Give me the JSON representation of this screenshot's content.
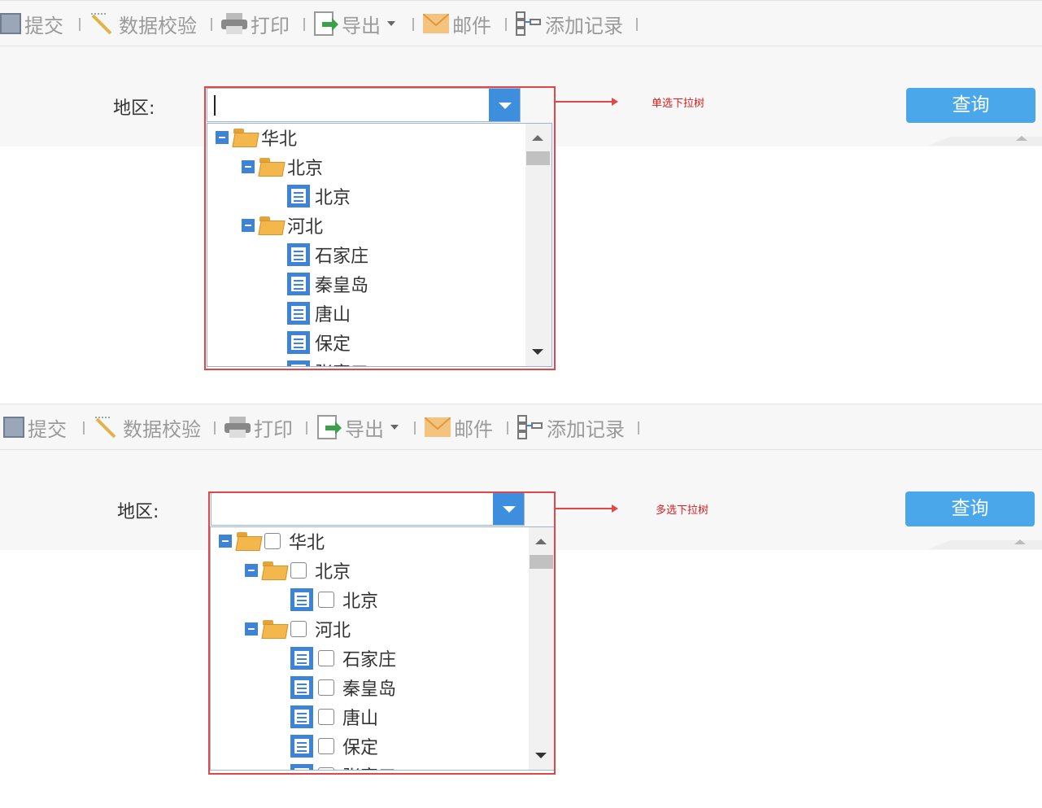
{
  "toolbar": {
    "submit": "提交",
    "validate": "数据校验",
    "print": "打印",
    "export": "导出",
    "mail": "邮件",
    "add_record": "添加记录"
  },
  "form": {
    "region_label": "地区:",
    "query_button": "查询"
  },
  "annotations": {
    "single": "单选下拉树",
    "multi": "多选下拉树"
  },
  "tree": {
    "root": "华北",
    "beijing_group": "北京",
    "beijing_leaf": "北京",
    "hebei_group": "河北",
    "leaves": [
      "石家庄",
      "秦皇岛",
      "唐山",
      "保定",
      "张家口"
    ]
  },
  "colors": {
    "accent": "#3d8fde",
    "query_button": "#4aa8ea",
    "annotation": "#e24747",
    "folder": "#f3b74b"
  }
}
